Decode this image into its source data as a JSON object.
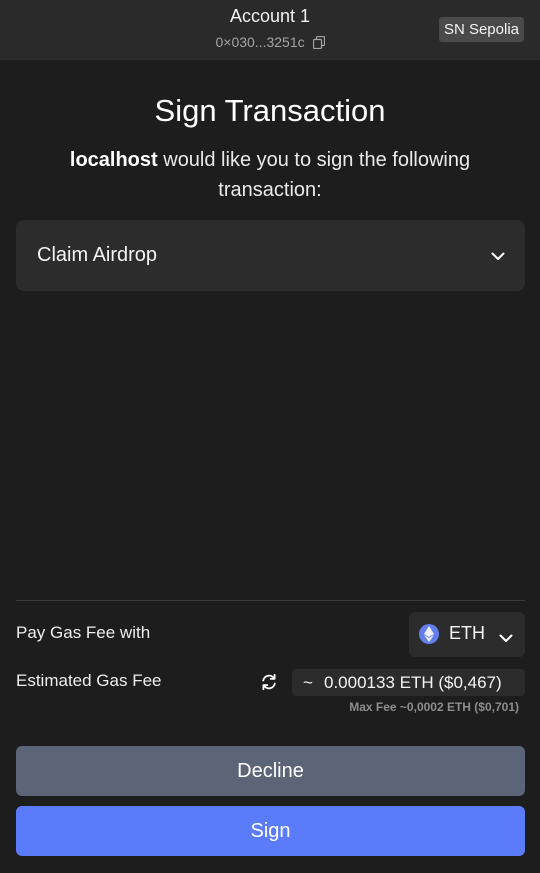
{
  "header": {
    "account_name": "Account 1",
    "account_address": "0×030...3251c",
    "network": "SN Sepolia"
  },
  "main": {
    "title": "Sign Transaction",
    "origin": "localhost",
    "message": " would like you to sign the following transaction:",
    "transaction_label": "Claim Airdrop"
  },
  "fees": {
    "pay_label": "Pay Gas Fee with",
    "token": "ETH",
    "estimated_label": "Estimated Gas Fee",
    "tilde": "~",
    "estimated_value": "0.000133 ETH ($0,467)",
    "max_fee": "Max Fee ~0,0002 ETH ($0,701)"
  },
  "actions": {
    "decline_label": "Decline",
    "sign_label": "Sign"
  },
  "colors": {
    "background": "#1d1d1d",
    "sign_button": "#5a7cfb",
    "decline_button": "#5c6477",
    "eth_icon": "#627eea"
  },
  "icons": [
    "copy-icon",
    "chevron-down-icon",
    "eth-icon",
    "refresh-icon"
  ]
}
